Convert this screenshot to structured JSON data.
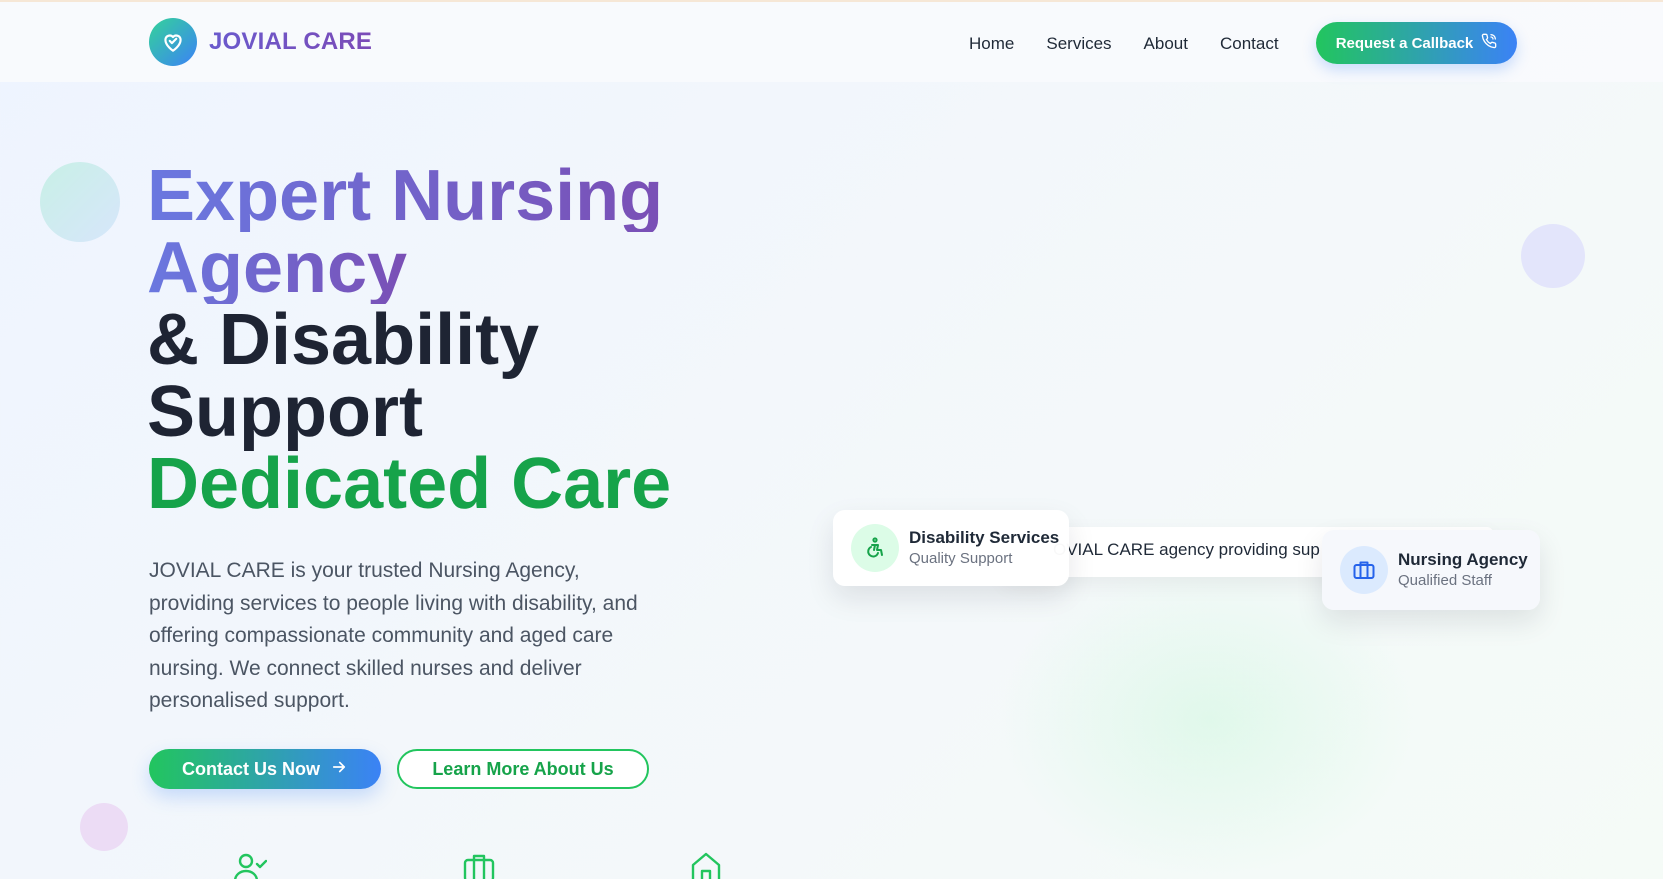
{
  "brand": {
    "name": "JOVIAL CARE"
  },
  "nav": {
    "items": [
      {
        "label": "Home"
      },
      {
        "label": "Services"
      },
      {
        "label": "About"
      },
      {
        "label": "Contact"
      }
    ],
    "cta_label": "Request a Callback"
  },
  "hero": {
    "title_line1": "Expert Nursing",
    "title_line2": "Agency",
    "title_line3": "& Disability",
    "title_line4": "Support",
    "title_line5": "Dedicated Care",
    "description": "JOVIAL CARE is your trusted Nursing Agency, providing services to people living with disability, and offering compassionate community and aged care nursing. We connect skilled nurses and deliver personalised support.",
    "primary_button": "Contact Us Now",
    "secondary_button": "Learn More About Us"
  },
  "image_strip": {
    "text": "OVIAL CARE agency providing sup"
  },
  "cards": [
    {
      "title": "Disability Services",
      "subtitle": "Quality Support",
      "icon": "wheelchair-icon"
    },
    {
      "title": "Nursing Agency",
      "subtitle": "Qualified Staff",
      "icon": "briefcase-icon"
    }
  ],
  "feature_icons": [
    "user-check-icon",
    "briefcase-icon",
    "home-icon"
  ],
  "colors": {
    "brand_gradient_start": "#22c55e",
    "brand_gradient_end": "#3b82f6",
    "title_gradient_start": "#6a78e0",
    "title_gradient_end": "#7a4fb5",
    "accent_green": "#16a34a",
    "heading_dark": "#1e2433"
  }
}
